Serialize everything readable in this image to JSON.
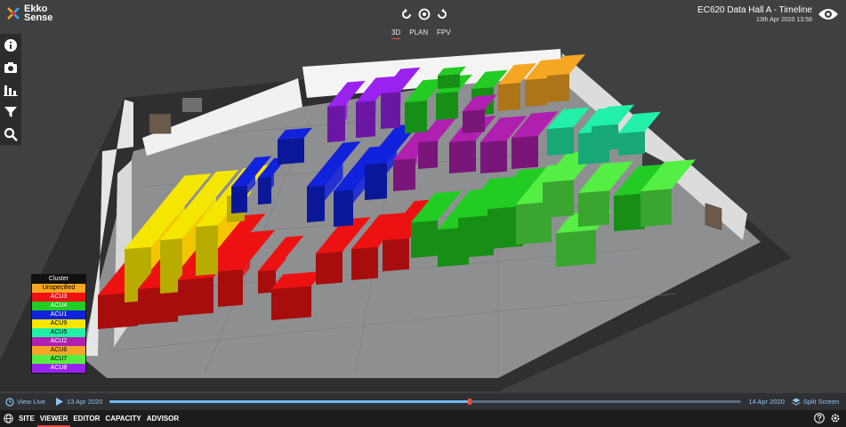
{
  "app": {
    "brand_line1": "Ekko",
    "brand_line2": "Sense",
    "logo_icon": "ekkosense-logo-icon"
  },
  "header": {
    "title": "EC620 Data Hall A - Timeline",
    "timestamp": "13th Apr 2020 13:58"
  },
  "view_modes": [
    {
      "label": "3D",
      "active": true
    },
    {
      "label": "PLAN",
      "active": false
    },
    {
      "label": "FPV",
      "active": false
    }
  ],
  "toolbar_icons": [
    "info-icon",
    "camera-icon",
    "bar-chart-icon",
    "filter-icon",
    "search-icon"
  ],
  "legend": {
    "title": "Cluster",
    "items": [
      {
        "label": "Unspecified",
        "color": "#f5a623",
        "text": "#000000"
      },
      {
        "label": "ACU3",
        "color": "#ee1111",
        "text": "#ffffff"
      },
      {
        "label": "ACU4",
        "color": "#22cc22",
        "text": "#ffffff"
      },
      {
        "label": "ACU1",
        "color": "#1122dd",
        "text": "#ffffff"
      },
      {
        "label": "ACU9",
        "color": "#f5e600",
        "text": "#000000"
      },
      {
        "label": "ACU5",
        "color": "#22f0a8",
        "text": "#000000"
      },
      {
        "label": "ACU2",
        "color": "#b01fb0",
        "text": "#ffffff"
      },
      {
        "label": "ACU6",
        "color": "#f5a623",
        "text": "#000000"
      },
      {
        "label": "ACU7",
        "color": "#55ee44",
        "text": "#000000"
      },
      {
        "label": "ACU8",
        "color": "#9a22ee",
        "text": "#ffffff"
      }
    ]
  },
  "timeline": {
    "view_live": "View Live",
    "start_date": "13 Apr 2020",
    "end_date": "14 Apr 2020",
    "progress": 0.57,
    "split_screen": "Split Screen"
  },
  "nav_tabs": [
    {
      "label": "SITE",
      "active": false
    },
    {
      "label": "VIEWER",
      "active": true
    },
    {
      "label": "EDITOR",
      "active": false
    },
    {
      "label": "CAPACITY",
      "active": false
    },
    {
      "label": "ADVISOR",
      "active": false
    }
  ],
  "scene": {
    "floor_color": "#8e8f91",
    "wall_color": "#f1f1f1",
    "rows": [
      {
        "cluster": "ACU3",
        "color": "#ee1111",
        "side": "#a80d0d"
      },
      {
        "cluster": "ACU9",
        "color": "#f5e600",
        "side": "#b8ac00"
      },
      {
        "cluster": "ACU1",
        "color": "#1122dd",
        "side": "#0b1799"
      },
      {
        "cluster": "ACU8",
        "color": "#9a22ee",
        "side": "#6b17a6"
      },
      {
        "cluster": "ACU2",
        "color": "#b01fb0",
        "side": "#7a157a"
      },
      {
        "cluster": "ACU4",
        "color": "#22cc22",
        "side": "#178f17"
      },
      {
        "cluster": "ACU7",
        "color": "#55ee44",
        "side": "#3aa52f"
      },
      {
        "cluster": "ACU6",
        "color": "#f5a623",
        "side": "#ad7418"
      },
      {
        "cluster": "ACU5",
        "color": "#22f0a8",
        "side": "#17a876"
      }
    ]
  }
}
